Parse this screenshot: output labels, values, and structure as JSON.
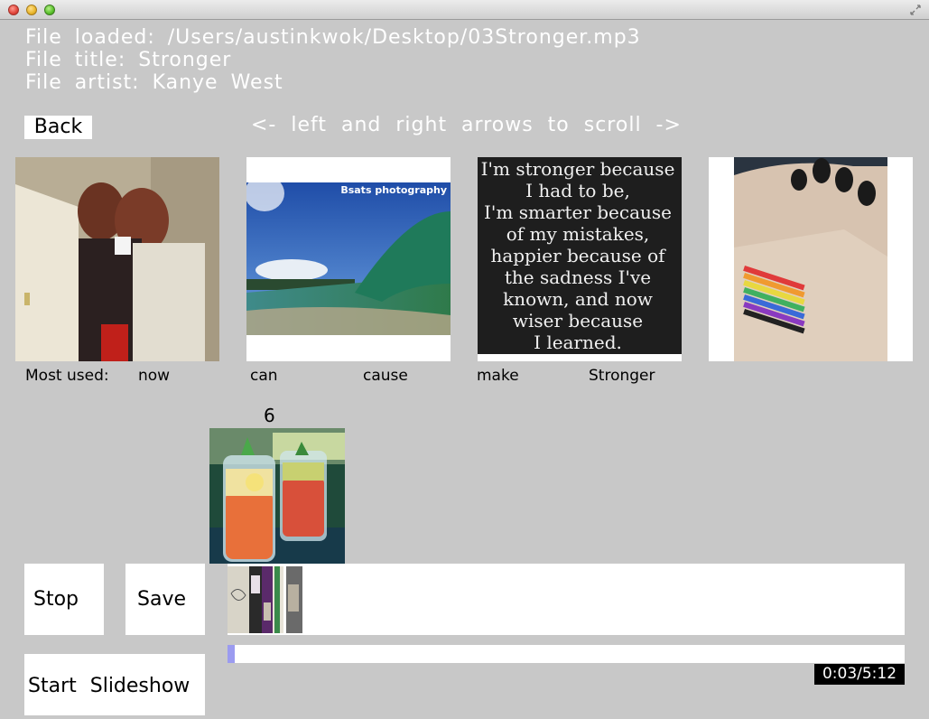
{
  "window": {
    "title": ""
  },
  "file_info": {
    "loaded": "File loaded: /Users/austinkwok/Desktop/03Stronger.mp3",
    "title": "File title: Stronger",
    "artist": "File artist: Kanye West"
  },
  "nav": {
    "back_label": "Back",
    "scroll_hint": "<- left and right arrows to scroll ->"
  },
  "gallery": {
    "images": [
      {
        "name": "couple-kiss-photo"
      },
      {
        "name": "ocean-wave-photo",
        "watermark": "Bsats photography"
      },
      {
        "name": "quote-image",
        "quote": [
          "I'm stronger because",
          "I had to be,",
          "I'm smarter because",
          "of my mistakes,",
          "happier because of",
          "the sadness I've",
          "known, and now",
          "wiser because",
          "I learned."
        ]
      },
      {
        "name": "wrist-tattoo-photo"
      }
    ]
  },
  "most_used": {
    "label": "Most used:",
    "words": [
      "now",
      "can",
      "cause",
      "make",
      "Stronger"
    ]
  },
  "selected": {
    "count": "6"
  },
  "controls": {
    "stop_label": "Stop",
    "save_label": "Save",
    "slideshow_label": "Start Slideshow"
  },
  "playback": {
    "progress": 0.0096,
    "time_display": "0:03/5:12",
    "fill_color": "#9b9bf0"
  }
}
